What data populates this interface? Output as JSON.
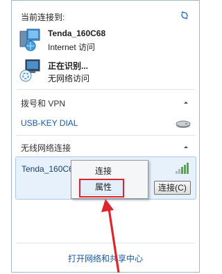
{
  "header": {
    "title": "当前连接到:"
  },
  "connections": [
    {
      "name": "Tenda_160C68",
      "status": "Internet 访问",
      "icon": "network-computer-icon"
    },
    {
      "name": "正在识别...",
      "status": "无网络访问",
      "icon": "network-identifying-icon"
    }
  ],
  "dialup": {
    "title": "拨号和 VPN",
    "item": "USB-KEY DIAL"
  },
  "wireless": {
    "title": "无线网络连接",
    "network_name": "Tenda_160C6",
    "connect_button": "连接(C)"
  },
  "context_menu": {
    "items": [
      "连接",
      "属性"
    ]
  },
  "footer": {
    "link": "打开网络和共享中心"
  },
  "colors": {
    "highlight_box": "#e0242c",
    "link": "#1a5aa8"
  }
}
